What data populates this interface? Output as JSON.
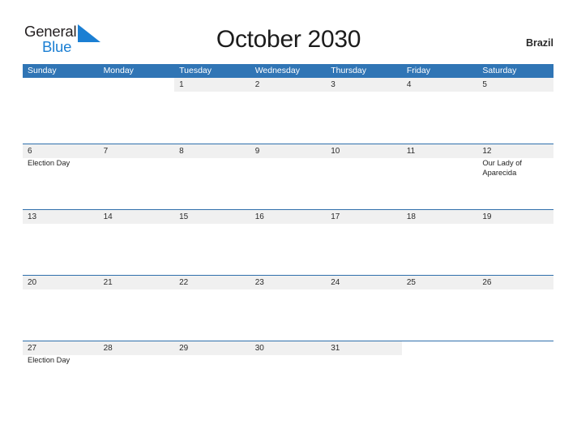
{
  "brand": {
    "name_part1": "General",
    "name_part2": "Blue",
    "logo_icon": "sail-triangle-icon",
    "color_dark": "#231f20",
    "color_blue": "#1b7fd3"
  },
  "header": {
    "title": "October 2030",
    "country": "Brazil"
  },
  "theme": {
    "header_blue": "#3075b5",
    "row_border_blue": "#2f6fac",
    "date_band_gray": "#f0f0f0",
    "page_background": "#ffffff"
  },
  "calendar": {
    "month": "October",
    "year": "2030",
    "weekday_headers": [
      "Sunday",
      "Monday",
      "Tuesday",
      "Wednesday",
      "Thursday",
      "Friday",
      "Saturday"
    ],
    "weeks": [
      {
        "days": [
          {
            "number": "",
            "events": [],
            "in_month": false
          },
          {
            "number": "",
            "events": [],
            "in_month": false
          },
          {
            "number": "1",
            "events": [],
            "in_month": true
          },
          {
            "number": "2",
            "events": [],
            "in_month": true
          },
          {
            "number": "3",
            "events": [],
            "in_month": true
          },
          {
            "number": "4",
            "events": [],
            "in_month": true
          },
          {
            "number": "5",
            "events": [],
            "in_month": true
          }
        ]
      },
      {
        "days": [
          {
            "number": "6",
            "events": [
              "Election Day"
            ],
            "in_month": true
          },
          {
            "number": "7",
            "events": [],
            "in_month": true
          },
          {
            "number": "8",
            "events": [],
            "in_month": true
          },
          {
            "number": "9",
            "events": [],
            "in_month": true
          },
          {
            "number": "10",
            "events": [],
            "in_month": true
          },
          {
            "number": "11",
            "events": [],
            "in_month": true
          },
          {
            "number": "12",
            "events": [
              "Our Lady of Aparecida"
            ],
            "in_month": true
          }
        ]
      },
      {
        "days": [
          {
            "number": "13",
            "events": [],
            "in_month": true
          },
          {
            "number": "14",
            "events": [],
            "in_month": true
          },
          {
            "number": "15",
            "events": [],
            "in_month": true
          },
          {
            "number": "16",
            "events": [],
            "in_month": true
          },
          {
            "number": "17",
            "events": [],
            "in_month": true
          },
          {
            "number": "18",
            "events": [],
            "in_month": true
          },
          {
            "number": "19",
            "events": [],
            "in_month": true
          }
        ]
      },
      {
        "days": [
          {
            "number": "20",
            "events": [],
            "in_month": true
          },
          {
            "number": "21",
            "events": [],
            "in_month": true
          },
          {
            "number": "22",
            "events": [],
            "in_month": true
          },
          {
            "number": "23",
            "events": [],
            "in_month": true
          },
          {
            "number": "24",
            "events": [],
            "in_month": true
          },
          {
            "number": "25",
            "events": [],
            "in_month": true
          },
          {
            "number": "26",
            "events": [],
            "in_month": true
          }
        ]
      },
      {
        "days": [
          {
            "number": "27",
            "events": [
              "Election Day"
            ],
            "in_month": true
          },
          {
            "number": "28",
            "events": [],
            "in_month": true
          },
          {
            "number": "29",
            "events": [],
            "in_month": true
          },
          {
            "number": "30",
            "events": [],
            "in_month": true
          },
          {
            "number": "31",
            "events": [],
            "in_month": true
          },
          {
            "number": "",
            "events": [],
            "in_month": false
          },
          {
            "number": "",
            "events": [],
            "in_month": false
          }
        ]
      }
    ]
  }
}
